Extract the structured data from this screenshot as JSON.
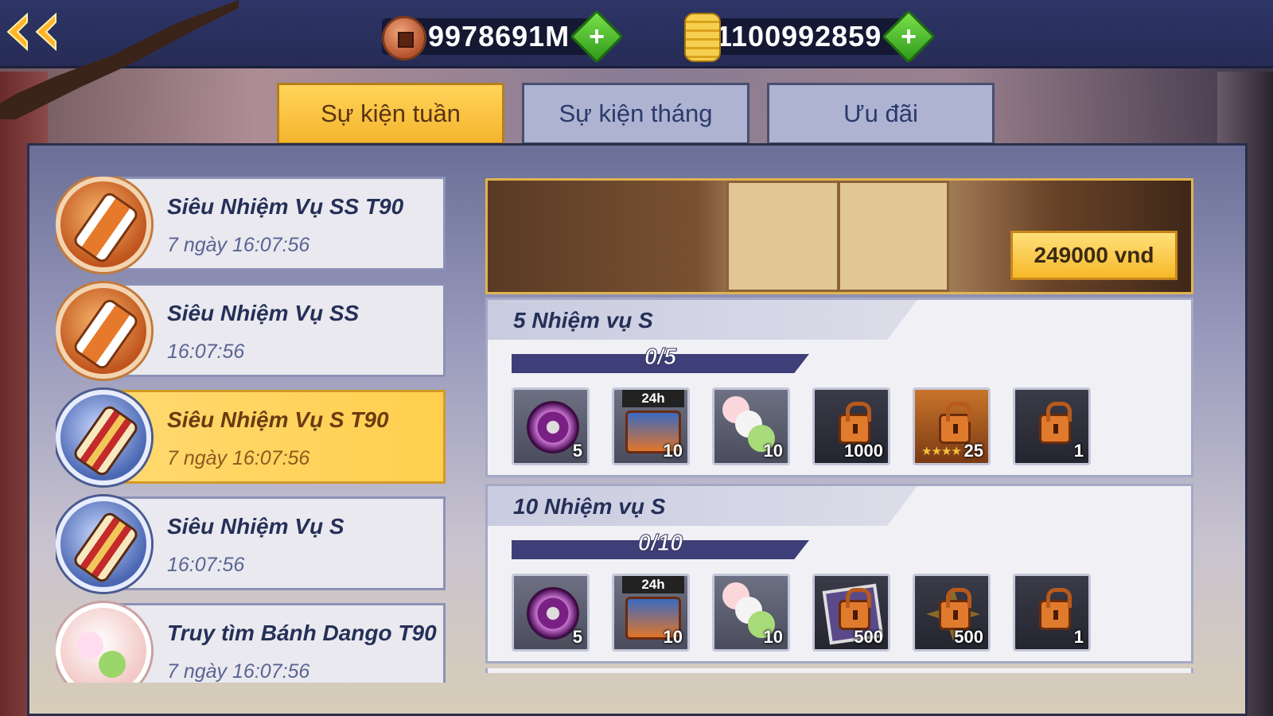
{
  "topbar": {
    "coins": {
      "value": "9978691M",
      "icon": "copper-coin-icon"
    },
    "gold": {
      "value": "1100992859",
      "icon": "gold-ingot-icon"
    }
  },
  "tabs": [
    {
      "label": "Sự kiện tuần",
      "active": true
    },
    {
      "label": "Sự kiện tháng",
      "active": false
    },
    {
      "label": "Ưu đãi",
      "active": false
    }
  ],
  "events": [
    {
      "title": "Siêu Nhiệm Vụ SS T90",
      "time": "7 ngày 16:07:56",
      "icon": "orange-scroll-icon"
    },
    {
      "title": "Siêu Nhiệm Vụ SS",
      "time": "16:07:56",
      "icon": "orange-scroll-icon"
    },
    {
      "title": "Siêu Nhiệm Vụ S T90",
      "time": "7 ngày 16:07:56",
      "icon": "red-scroll-icon",
      "active": true
    },
    {
      "title": "Siêu Nhiệm Vụ S",
      "time": "16:07:56",
      "icon": "red-scroll-icon"
    },
    {
      "title": "Truy tìm Bánh Dango T90",
      "time": "7 ngày 16:07:56",
      "icon": "dango-icon"
    }
  ],
  "banner": {
    "price": "249000 vnd"
  },
  "missions": [
    {
      "title": "5 Nhiệm vụ S",
      "progress": "0/5",
      "rewards": [
        {
          "icon": "ninja-chip-icon",
          "qty": "5",
          "locked": false
        },
        {
          "icon": "chest-icon",
          "qty": "10",
          "tag": "24h",
          "locked": false
        },
        {
          "icon": "dango-icon",
          "qty": "10",
          "locked": false
        },
        {
          "icon": "locked-coin-pouch-icon",
          "qty": "1000",
          "locked": true
        },
        {
          "icon": "locked-ninja-card-icon",
          "qty": "25",
          "locked": true
        },
        {
          "icon": "locked-scroll-icon",
          "qty": "1",
          "locked": true
        }
      ]
    },
    {
      "title": "10 Nhiệm vụ S",
      "progress": "0/10",
      "rewards": [
        {
          "icon": "ninja-chip-icon",
          "qty": "5",
          "locked": false
        },
        {
          "icon": "chest-icon",
          "qty": "10",
          "tag": "24h",
          "locked": false
        },
        {
          "icon": "dango-icon",
          "qty": "10",
          "locked": false
        },
        {
          "icon": "locked-photo-icon",
          "qty": "500",
          "locked": true
        },
        {
          "icon": "locked-shuriken-icon",
          "qty": "500",
          "locked": true
        },
        {
          "icon": "locked-scroll-icon",
          "qty": "1",
          "locked": true
        }
      ]
    }
  ]
}
